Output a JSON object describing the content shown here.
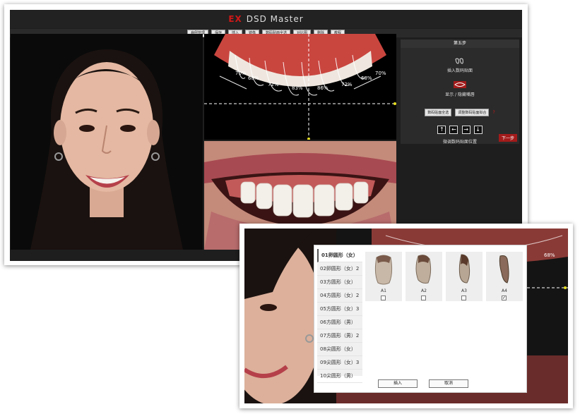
{
  "app": {
    "title_prefix": "EX",
    "title": "DSD Master"
  },
  "menu": [
    "病例管理",
    "保存",
    "插入",
    "镜像",
    "数码贴面全选",
    "对比图",
    "删除",
    "教程"
  ],
  "tooth_labels": [
    "70%",
    "68%",
    "72%",
    "83%",
    "86%",
    "72%",
    "68%",
    "70%"
  ],
  "step_panel": {
    "title": "第五步",
    "insert_label": "插入数码贴面",
    "toggle_label": "显示 / 隐藏嘴唇",
    "select_all_label": "数码贴面全选",
    "fit_label": "调整数码贴面拟合",
    "help_mark": "?",
    "adjust_label": "微调数码贴面位置",
    "next_label": "下一步",
    "arrows": [
      "↑",
      "←",
      "→",
      "↓"
    ]
  },
  "bg_tooth_label": "68%",
  "dialog": {
    "categories": [
      "01卵圆形（女）",
      "02卵圆形（女）2",
      "03方圆形（女）",
      "04方圆形（女）2",
      "05方圆形（女）3",
      "06方圆形（男）",
      "07方圆形（男）2",
      "08尖圆形（女）",
      "09尖圆形（女）3",
      "10尖圆形（男）"
    ],
    "tooth_models": [
      {
        "label": "A1",
        "checked": false
      },
      {
        "label": "A2",
        "checked": false
      },
      {
        "label": "A3",
        "checked": false
      },
      {
        "label": "A4",
        "checked": true
      }
    ],
    "insert_label": "插入",
    "cancel_label": "取消"
  },
  "colors": {
    "brand_red": "#d01818",
    "next_button": "#a31b1b",
    "guide_yellow": "#e8e020"
  }
}
